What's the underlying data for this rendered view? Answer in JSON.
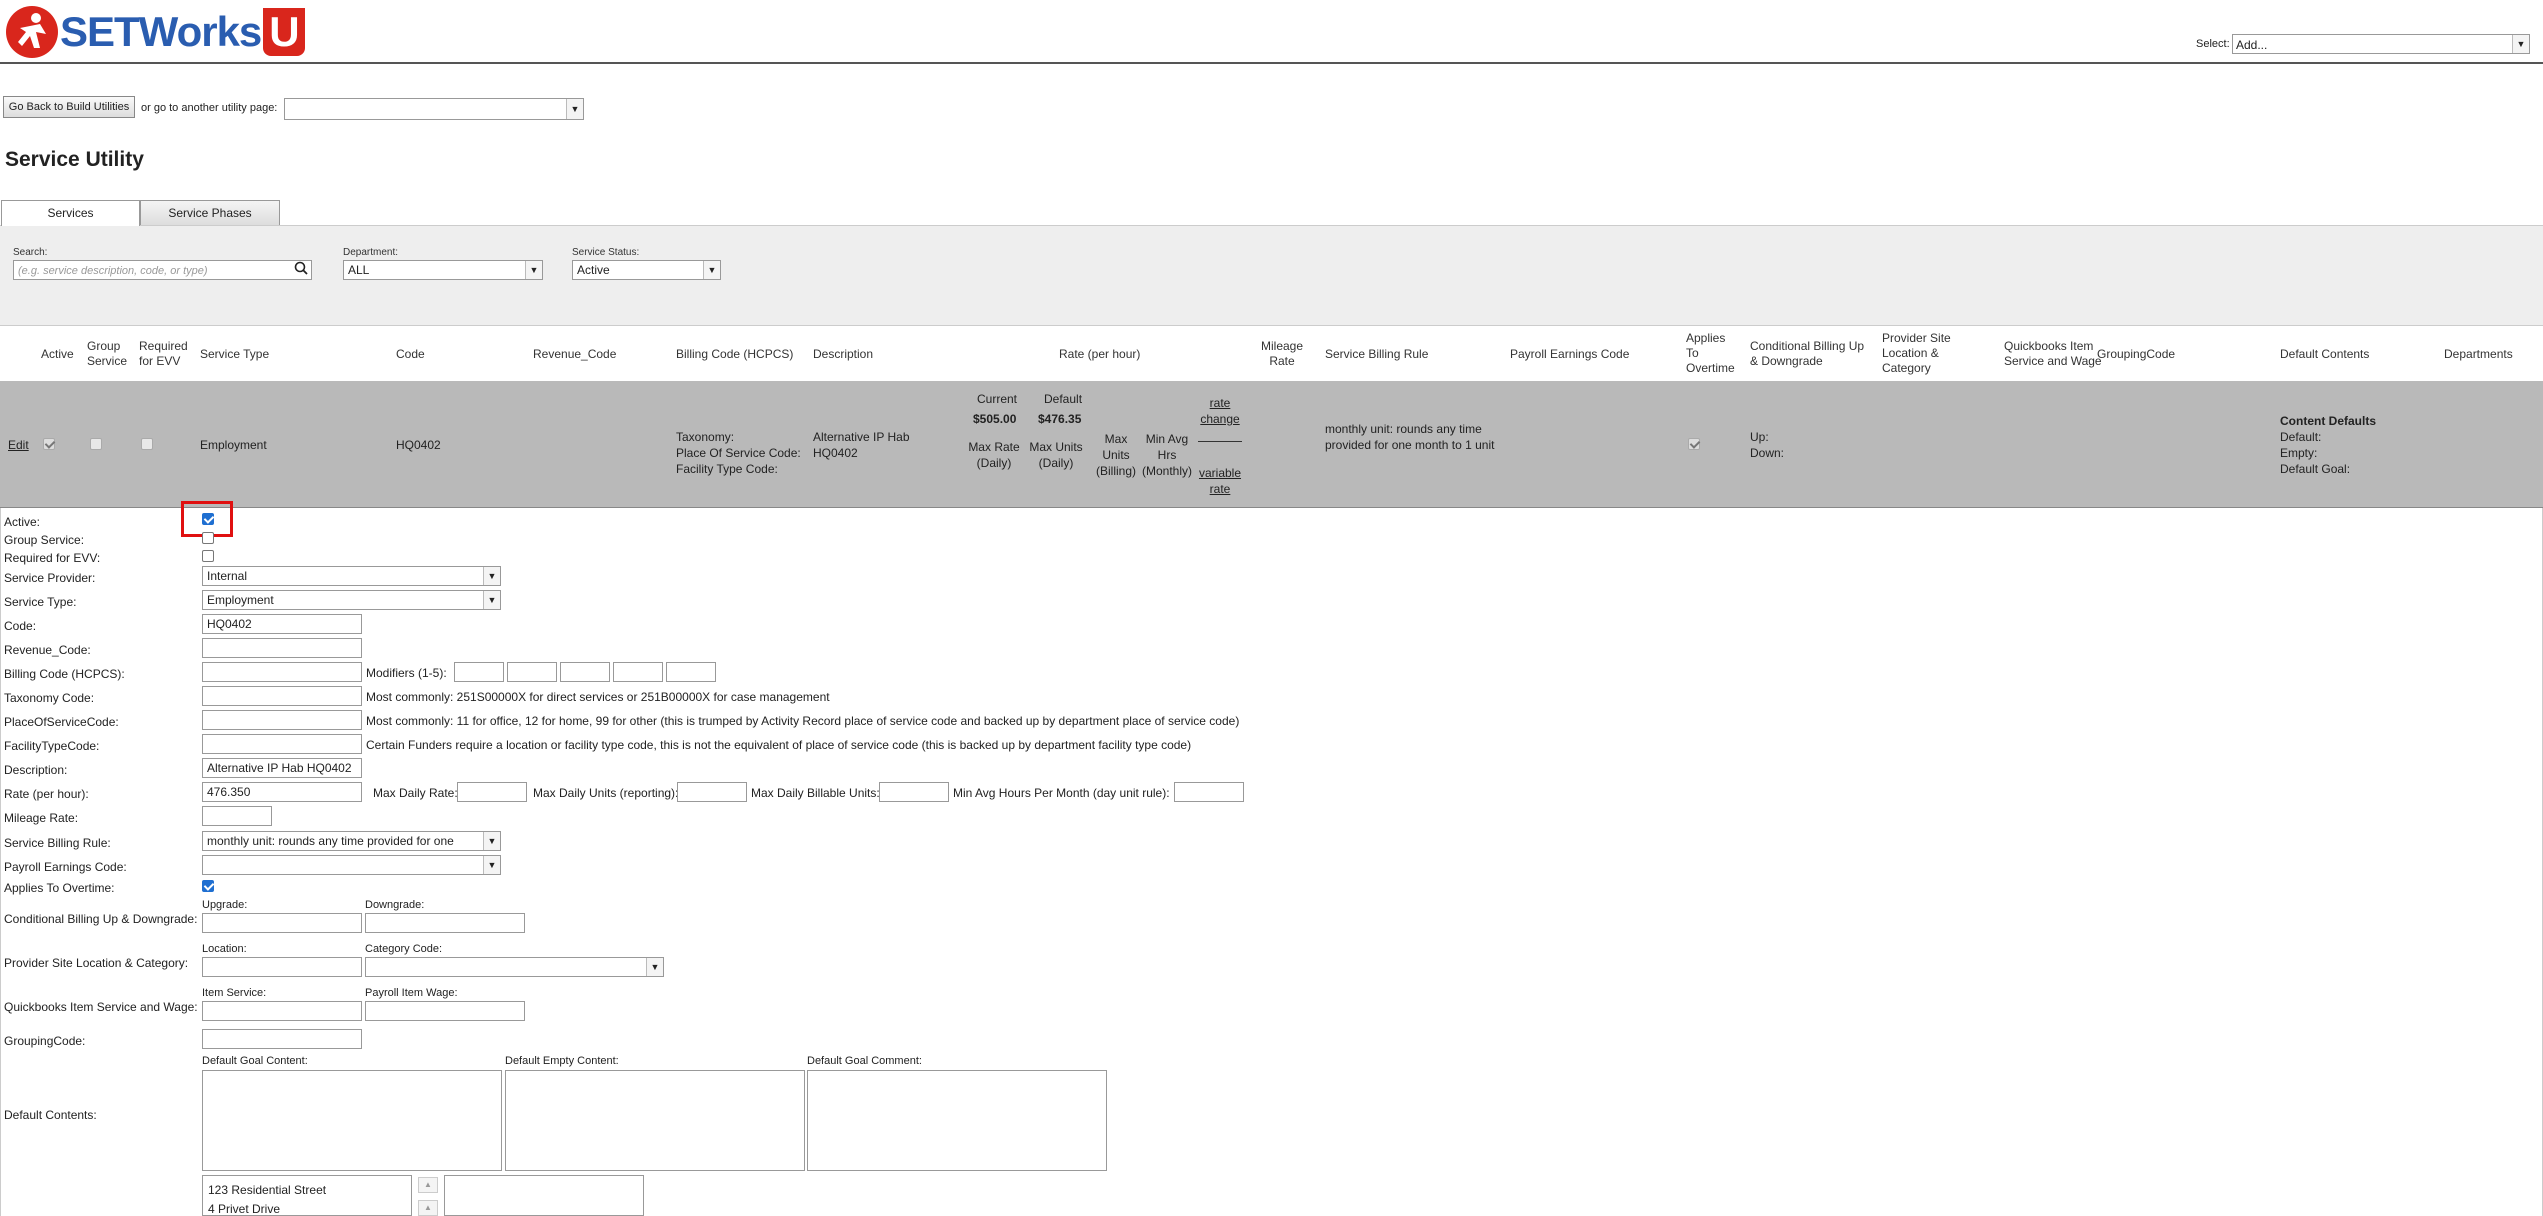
{
  "header": {
    "logo_text": "SETWorks",
    "logo_u": "U",
    "select_label": "Select:",
    "select_value": "Add..."
  },
  "nav": {
    "back_button": "Go Back to Build Utilities",
    "goto_label": "or go to another utility page:",
    "goto_value": ""
  },
  "page_title": "Service Utility",
  "tabs": [
    {
      "label": "Services",
      "active": true
    },
    {
      "label": "Service Phases",
      "active": false
    }
  ],
  "filters": {
    "search_label": "Search:",
    "search_placeholder": "(e.g. service description, code, or type)",
    "department_label": "Department:",
    "department_value": "ALL",
    "status_label": "Service Status:",
    "status_value": "Active"
  },
  "grid": {
    "headers": {
      "active": "Active",
      "group_service": "Group Service",
      "required_evv": "Required for EVV",
      "service_type": "Service Type",
      "code": "Code",
      "revenue_code": "Revenue_Code",
      "billing_code": "Billing Code (HCPCS)",
      "description": "Description",
      "rate": "Rate (per hour)",
      "mileage_rate": "Mileage Rate",
      "billing_rule": "Service Billing Rule",
      "payroll_code": "Payroll Earnings Code",
      "applies_overtime": "Applies To Overtime",
      "conditional_billing": "Conditional Billing Up & Downgrade",
      "provider_site": "Provider Site Location & Category",
      "quickbooks": "Quickbooks Item Service and Wage",
      "grouping_code": "GroupingCode",
      "default_contents": "Default Contents",
      "departments": "Departments"
    },
    "row": {
      "edit": "Edit",
      "active": true,
      "group_service": false,
      "required_evv": false,
      "service_type": "Employment",
      "code": "HQ0402",
      "billing_taxonomy": "Taxonomy:",
      "billing_pos": "Place Of Service Code:",
      "billing_facility": "Facility Type Code:",
      "description": "Alternative IP Hab HQ0402",
      "rate_current_label": "Current",
      "rate_current": "$505.00",
      "rate_default_label": "Default",
      "rate_default": "$476.35",
      "max_rate_label": "Max Rate (Daily)",
      "max_units_label": "Max Units (Daily)",
      "max_units_billing_label": "Max Units (Billing)",
      "min_avg_label": "Min Avg Hrs (Monthly)",
      "rate_change": "rate change",
      "variable_rate": "variable rate",
      "billing_rule": "monthly unit: rounds any time provided for one month to 1 unit",
      "applies_overtime": true,
      "up_label": "Up:",
      "down_label": "Down:",
      "content_defaults": "Content Defaults",
      "default_label": "Default:",
      "empty_label": "Empty:",
      "default_goal_label": "Default Goal:"
    }
  },
  "form": {
    "active_label": "Active:",
    "active": true,
    "group_label": "Group Service:",
    "evv_label": "Required for EVV:",
    "provider_label": "Service Provider:",
    "provider_value": "Internal",
    "type_label": "Service Type:",
    "type_value": "Employment",
    "code_label": "Code:",
    "code_value": "HQ0402",
    "revenue_label": "Revenue_Code:",
    "billing_label": "Billing Code (HCPCS):",
    "modifiers_label": "Modifiers (1-5):",
    "taxonomy_label": "Taxonomy Code:",
    "taxonomy_hint": "Most commonly: 251S00000X for direct services or 251B00000X for case management",
    "pos_label": "PlaceOfServiceCode:",
    "pos_hint": "Most commonly: 11 for office, 12 for home, 99 for other (this is trumped by Activity Record place of service code and backed up by department place of service code)",
    "facility_label": "FacilityTypeCode:",
    "facility_hint": "Certain Funders require a location or facility type code, this is not the equivalent of place of service code (this is backed up by department facility type code)",
    "description_label": "Description:",
    "description_value": "Alternative IP Hab HQ0402",
    "rate_label": "Rate (per hour):",
    "rate_value": "476.350",
    "max_daily_rate_label": "Max Daily Rate:",
    "max_daily_units_label": "Max Daily Units (reporting):",
    "max_daily_billable_label": "Max Daily Billable Units:",
    "min_avg_hours_label": "Min Avg Hours Per Month (day unit rule):",
    "mileage_label": "Mileage Rate:",
    "billing_rule_label": "Service Billing Rule:",
    "billing_rule_value": "monthly unit: rounds any time provided for one",
    "payroll_label": "Payroll Earnings Code:",
    "overtime_label": "Applies To Overtime:",
    "conditional_label": "Conditional Billing Up & Downgrade:",
    "upgrade_label": "Upgrade:",
    "downgrade_label": "Downgrade:",
    "provider_site_label": "Provider Site Location & Category:",
    "location_label": "Location:",
    "category_label": "Category Code:",
    "quickbooks_label": "Quickbooks Item Service and Wage:",
    "item_service_label": "Item Service:",
    "payroll_wage_label": "Payroll Item Wage:",
    "grouping_label": "GroupingCode:",
    "default_contents_label": "Default Contents:",
    "goal_content_label": "Default Goal Content:",
    "empty_content_label": "Default Empty Content:",
    "goal_comment_label": "Default Goal Comment:",
    "locations": [
      "123 Residential Street",
      "4 Privet Drive"
    ]
  },
  "colors": {
    "brand_blue": "#2a5db0",
    "brand_red": "#d9261c",
    "highlight_red": "#e01010",
    "row_gray": "#b9b9b9"
  }
}
